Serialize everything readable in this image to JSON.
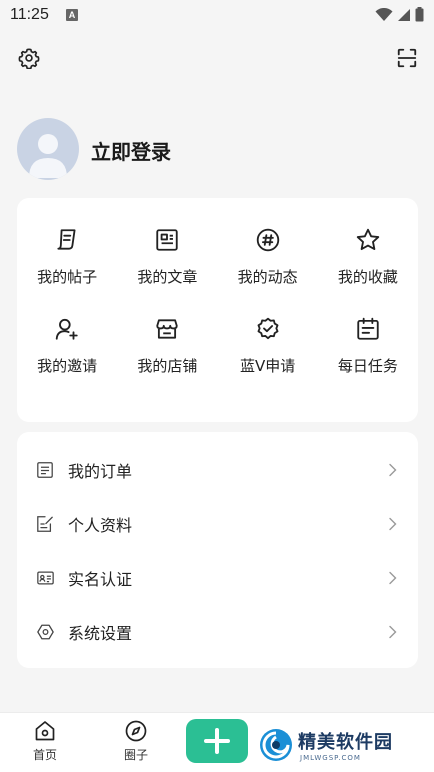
{
  "status_bar": {
    "time": "11:25",
    "notif_badge": "A"
  },
  "header": {
    "settings_icon": "gear-icon",
    "scan_icon": "scan-icon"
  },
  "profile": {
    "login_text": "立即登录"
  },
  "quick_grid": [
    {
      "label": "我的帖子",
      "icon": "post-icon"
    },
    {
      "label": "我的文章",
      "icon": "article-icon"
    },
    {
      "label": "我的动态",
      "icon": "hashtag-icon"
    },
    {
      "label": "我的收藏",
      "icon": "star-icon"
    },
    {
      "label": "我的邀请",
      "icon": "invite-user-icon"
    },
    {
      "label": "我的店铺",
      "icon": "store-icon"
    },
    {
      "label": "蓝V申请",
      "icon": "verified-badge-icon"
    },
    {
      "label": "每日任务",
      "icon": "calendar-task-icon"
    }
  ],
  "menu_list": [
    {
      "label": "我的订单",
      "icon": "order-icon"
    },
    {
      "label": "个人资料",
      "icon": "edit-profile-icon"
    },
    {
      "label": "实名认证",
      "icon": "id-card-icon"
    },
    {
      "label": "系统设置",
      "icon": "hexagon-settings-icon"
    }
  ],
  "bottom_nav": {
    "home": "首页",
    "circle": "圈子",
    "add_icon": "plus-icon",
    "watermark": {
      "title": "精美软件园",
      "subtitle": "JMLWGSP.COM"
    }
  },
  "colors": {
    "accent": "#2bbf94",
    "background": "#f5f5f5",
    "card": "#ffffff"
  }
}
